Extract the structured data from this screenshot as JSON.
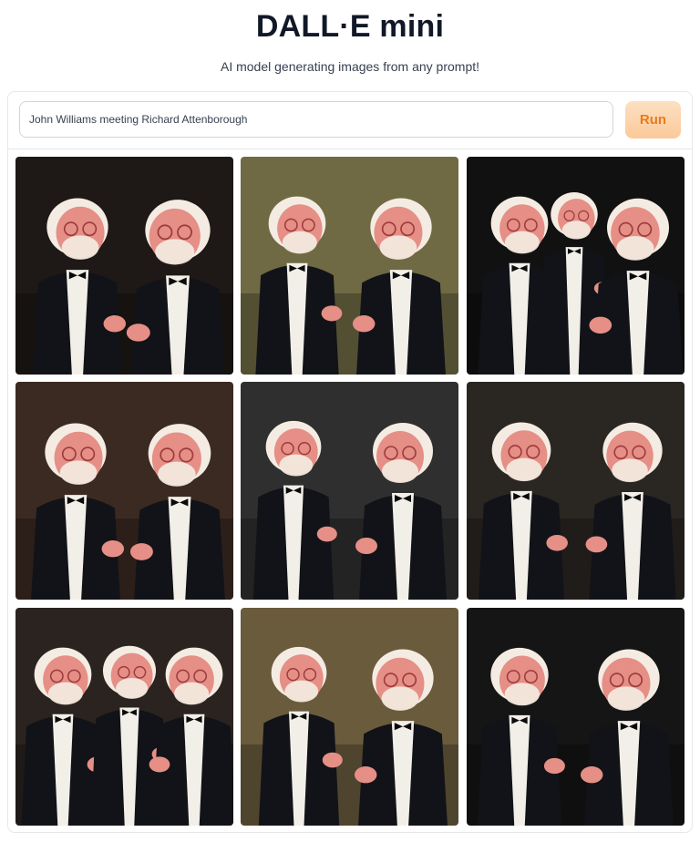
{
  "app": {
    "title": "DALL·E mini",
    "subtitle": "AI model generating images from any prompt!"
  },
  "prompt": {
    "value": "John Williams meeting Richard Attenborough",
    "placeholder": "John Williams meeting Richard Attenborough"
  },
  "run_button": {
    "label": "Run"
  },
  "gallery": {
    "count": 9,
    "colors": {
      "suit": "#111318",
      "shirt": "#f2efe8",
      "face": "#e58f86",
      "hair": "#f4ece2",
      "backgrounds": [
        "#1e1816",
        "#6f6a43",
        "#111111",
        "#3b2a22",
        "#2f2f2f",
        "#2a2622",
        "#2a2320",
        "#6a5b3c",
        "#151515"
      ]
    }
  }
}
